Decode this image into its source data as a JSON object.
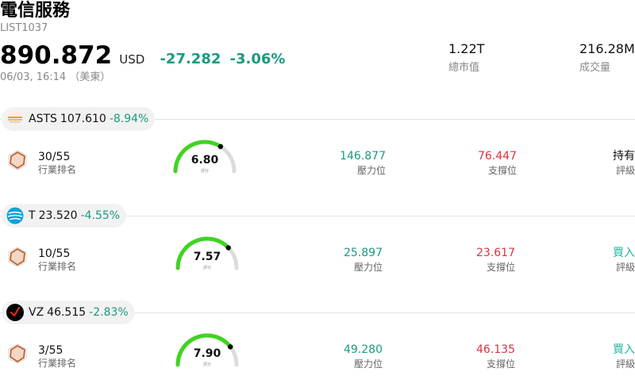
{
  "header": {
    "title": "電信服務",
    "code": "LIST1037",
    "price": "890.872",
    "currency": "USD",
    "change": "-27.282",
    "change_pct": "-3.06%",
    "timestamp": "06/03, 16:14 （美東）",
    "market_cap": {
      "value": "1.22T",
      "label": "總市值"
    },
    "volume": {
      "value": "216.28M",
      "label": "成交量"
    }
  },
  "colors": {
    "up_green": "#1a9a7f",
    "support_red": "#e0313e",
    "buy_teal": "#23b5a3",
    "gauge_green": "#3fd421",
    "gauge_track": "#dcdcdc"
  },
  "stocks": [
    {
      "ticker": "ASTS",
      "price": "107.610",
      "change_pct": "-8.94%",
      "logo": "asts-logo",
      "rank": "30/55",
      "rank_label": "行業排名",
      "score": "6.80",
      "score_label": "評分",
      "score_level": 0.68,
      "resistance": "146.877",
      "resistance_label": "壓力位",
      "support": "76.447",
      "support_label": "支撐位",
      "rating": "持有",
      "rating_label": "評級",
      "rating_color": "#111111"
    },
    {
      "ticker": "T",
      "price": "23.520",
      "change_pct": "-4.55%",
      "logo": "att-globe-logo",
      "rank": "10/55",
      "rank_label": "行業排名",
      "score": "7.57",
      "score_label": "評分",
      "score_level": 0.757,
      "resistance": "25.897",
      "resistance_label": "壓力位",
      "support": "23.617",
      "support_label": "支撐位",
      "rating": "買入",
      "rating_label": "評級",
      "rating_color": "#23b5a3"
    },
    {
      "ticker": "VZ",
      "price": "46.515",
      "change_pct": "-2.83%",
      "logo": "verizon-check-logo",
      "rank": "3/55",
      "rank_label": "行業排名",
      "score": "7.90",
      "score_label": "評分",
      "score_level": 0.79,
      "resistance": "49.280",
      "resistance_label": "壓力位",
      "support": "46.135",
      "support_label": "支撐位",
      "rating": "買入",
      "rating_label": "評級",
      "rating_color": "#23b5a3"
    }
  ]
}
